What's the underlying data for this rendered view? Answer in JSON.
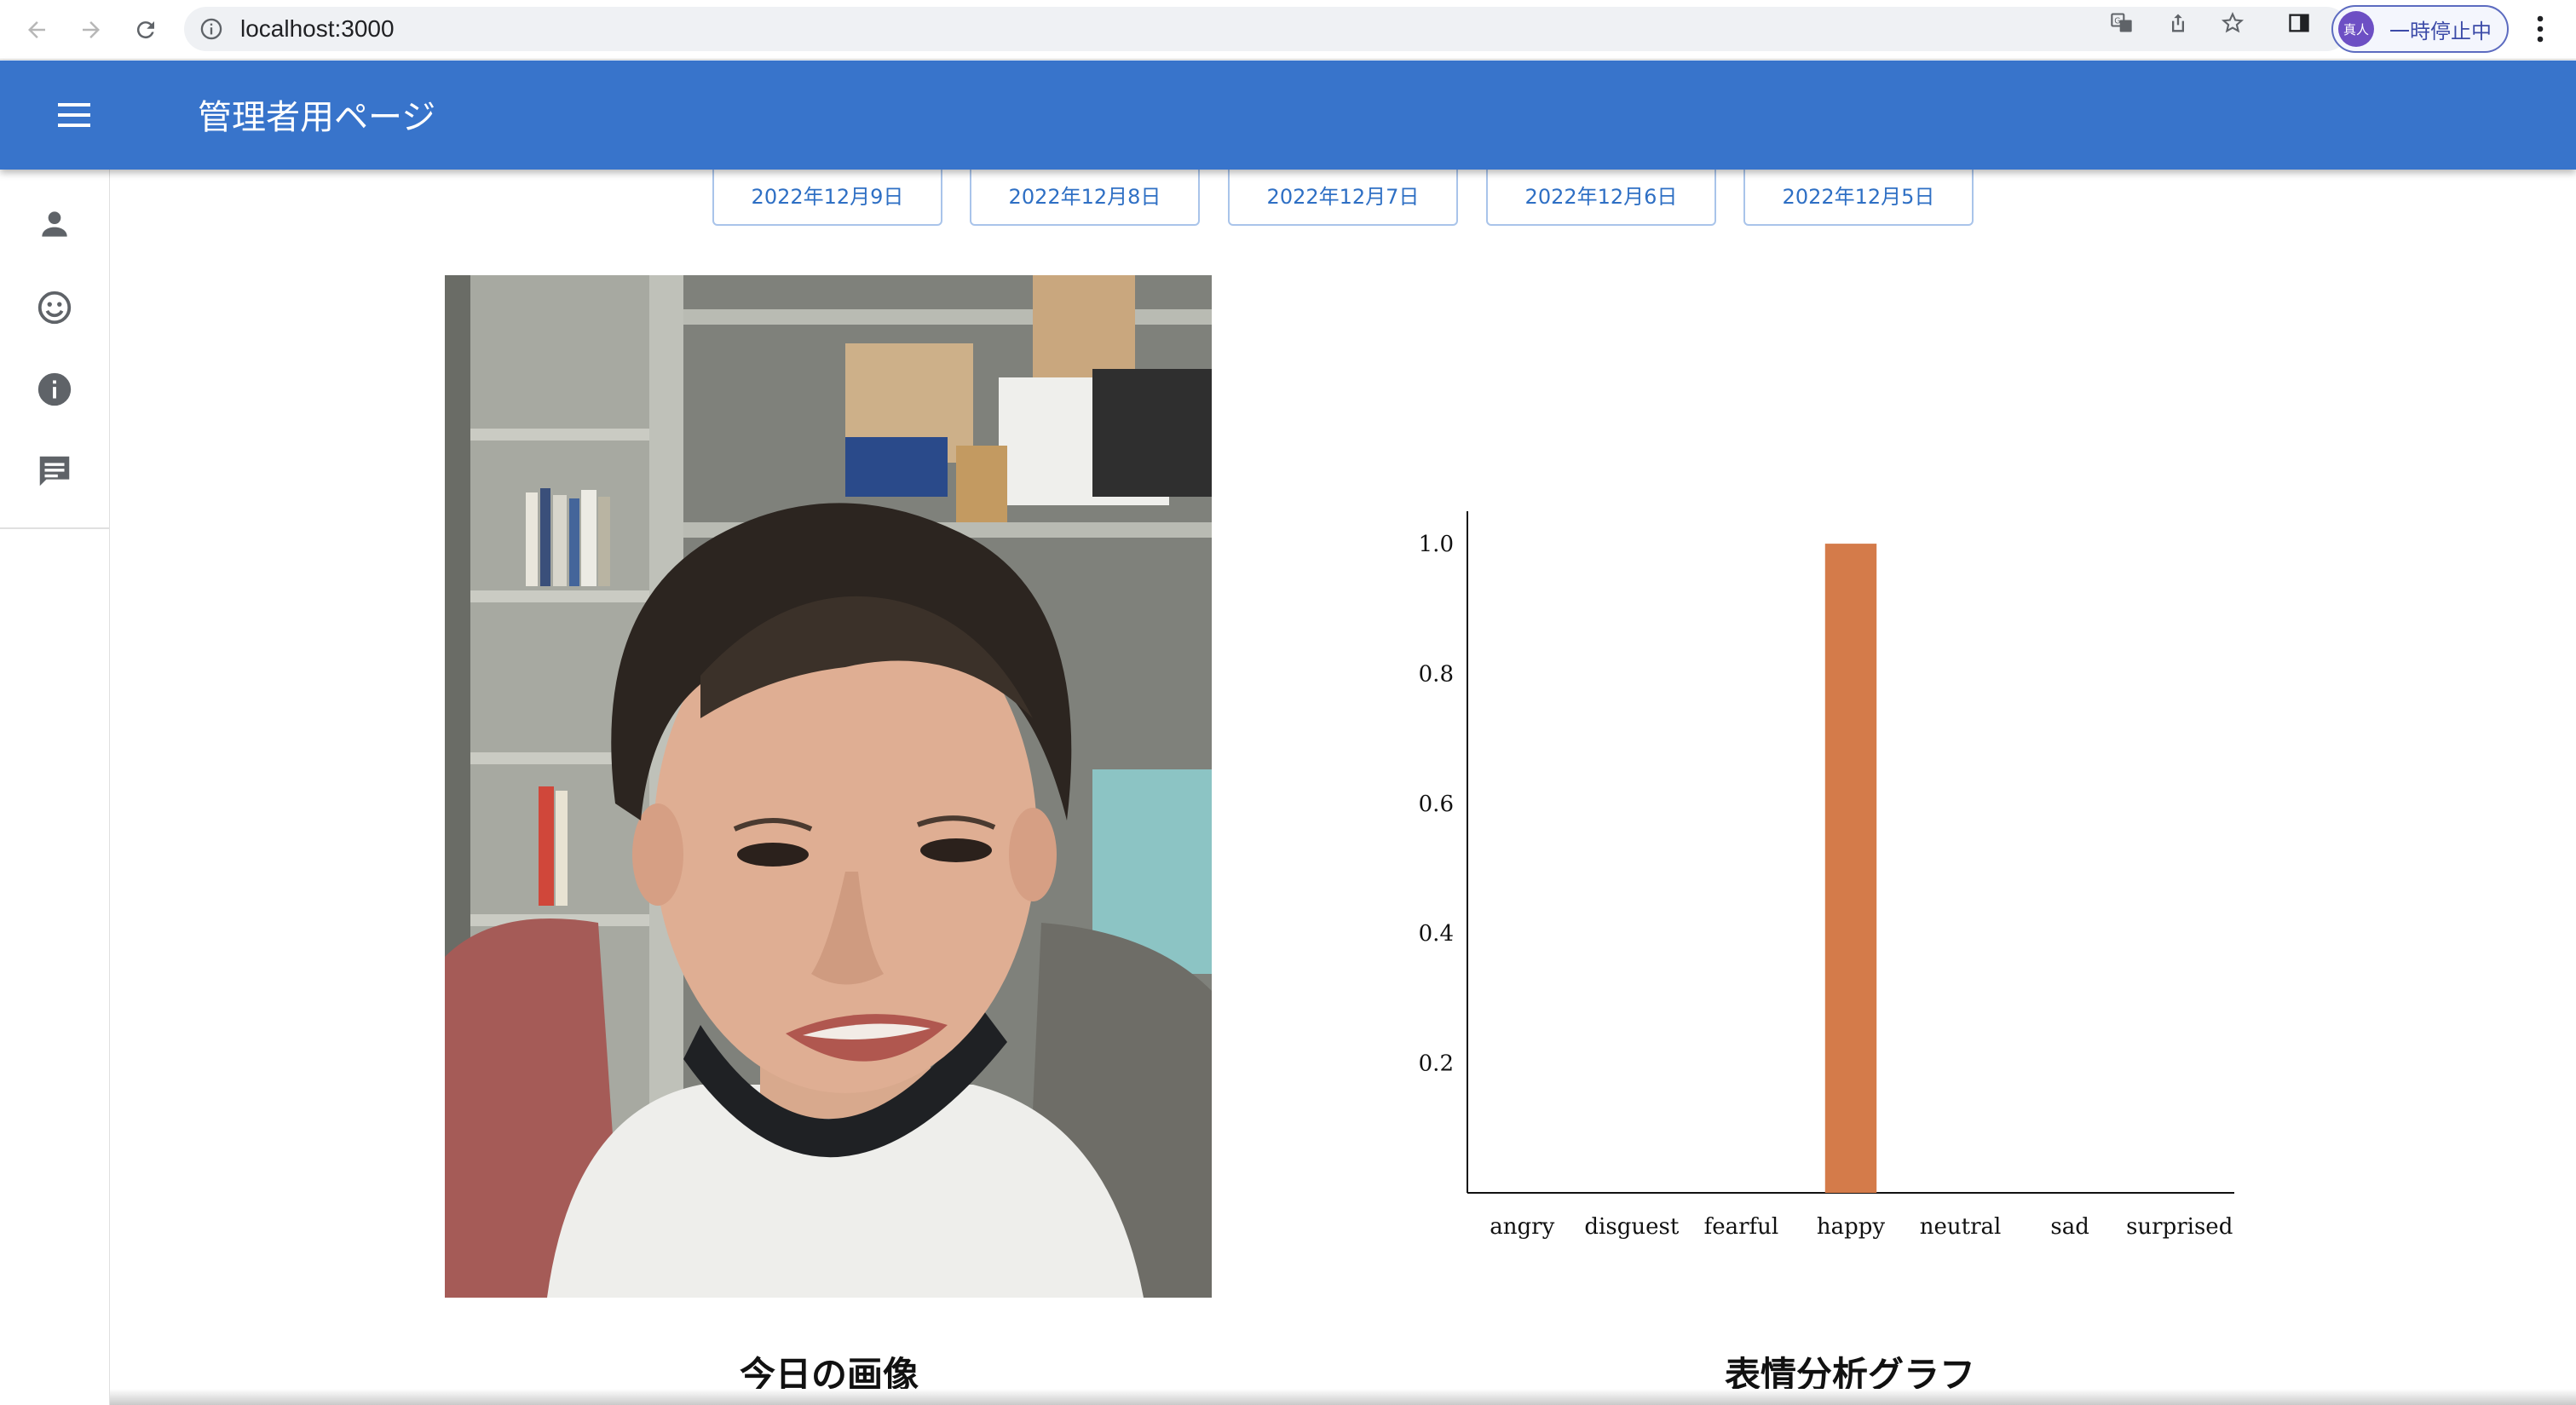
{
  "browser": {
    "url": "localhost:3000",
    "profile_avatar": "真人",
    "profile_status": "一時停止中",
    "icons": [
      "back-arrow-icon",
      "forward-arrow-icon",
      "reload-icon",
      "info-icon",
      "translate-icon",
      "share-icon",
      "star-icon",
      "side-panel-icon",
      "more-vert-icon"
    ]
  },
  "appbar": {
    "title": "管理者用ページ",
    "color": "#3874cb",
    "menu_icon": "menu-icon"
  },
  "drawer": {
    "items": [
      {
        "icon": "person-icon"
      },
      {
        "icon": "smiley-face-icon"
      },
      {
        "icon": "info-icon"
      },
      {
        "icon": "chat-message-icon"
      }
    ]
  },
  "dates": [
    "2022年12月9日",
    "2022年12月8日",
    "2022年12月7日",
    "2022年12月6日",
    "2022年12月5日"
  ],
  "photo": {
    "caption": "今日の画像"
  },
  "chart_caption": "表情分析グラフ",
  "chart_data": {
    "type": "bar",
    "categories": [
      "angry",
      "disguest",
      "fearful",
      "happy",
      "neutral",
      "sad",
      "surprised"
    ],
    "values": [
      0,
      0,
      0,
      1.0,
      0,
      0,
      0
    ],
    "ylim": [
      0,
      1.05
    ],
    "yticks": [
      "1.0",
      "0.8",
      "0.6",
      "0.4",
      "0.2"
    ],
    "bar_color": "#d47b4a",
    "grid": false,
    "title": "",
    "xlabel": "",
    "ylabel": ""
  }
}
